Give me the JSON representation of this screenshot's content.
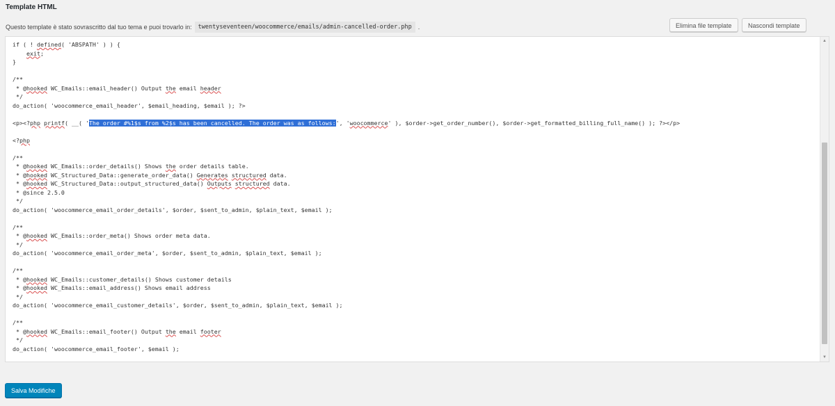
{
  "section": {
    "title": "Template HTML"
  },
  "notice": {
    "text": "Questo template è stato sovrascritto dal tuo tema e puoi trovarlo in:",
    "path": "twentyseventeen/woocommerce/emails/admin-cancelled-order.php",
    "suffix": "."
  },
  "buttons": {
    "delete_label": "Elimina file template",
    "hide_label": "Nascondi template",
    "save_label": "Salva Modifiche"
  },
  "editor": {
    "selected_text": "The order #%1$s from %2$s has been cancelled. The order was as follows:",
    "lines": [
      "if ( ! defined( 'ABSPATH' ) ) {",
      "\texit;",
      "}",
      "",
      "/**",
      " * @hooked WC_Emails::email_header() Output the email header",
      " */",
      "do_action( 'woocommerce_email_header', $email_heading, $email ); ?>",
      "",
      "<p><?php printf( __( 'The order #%1$s from %2$s has been cancelled. The order was as follows:', 'woocommerce' ), $order->get_order_number(), $order->get_formatted_billing_full_name() ); ?></p>",
      "",
      "<?php",
      "",
      "/**",
      " * @hooked WC_Emails::order_details() Shows the order details table.",
      " * @hooked WC_Structured_Data::generate_order_data() Generates structured data.",
      " * @hooked WC_Structured_Data::output_structured_data() Outputs structured data.",
      " * @since 2.5.0",
      " */",
      "do_action( 'woocommerce_email_order_details', $order, $sent_to_admin, $plain_text, $email );",
      "",
      "/**",
      " * @hooked WC_Emails::order_meta() Shows order meta data.",
      " */",
      "do_action( 'woocommerce_email_order_meta', $order, $sent_to_admin, $plain_text, $email );",
      "",
      "/**",
      " * @hooked WC_Emails::customer_details() Shows customer details",
      " * @hooked WC_Emails::email_address() Shows email address",
      " */",
      "do_action( 'woocommerce_email_customer_details', $order, $sent_to_admin, $plain_text, $email );",
      "",
      "/**",
      " * @hooked WC_Emails::email_footer() Output the email footer",
      " */",
      "do_action( 'woocommerce_email_footer', $email );"
    ]
  },
  "colors": {
    "primary_button": "#0085ba",
    "selection": "#2f6fd7",
    "spellcheck": "#d94f4f"
  }
}
